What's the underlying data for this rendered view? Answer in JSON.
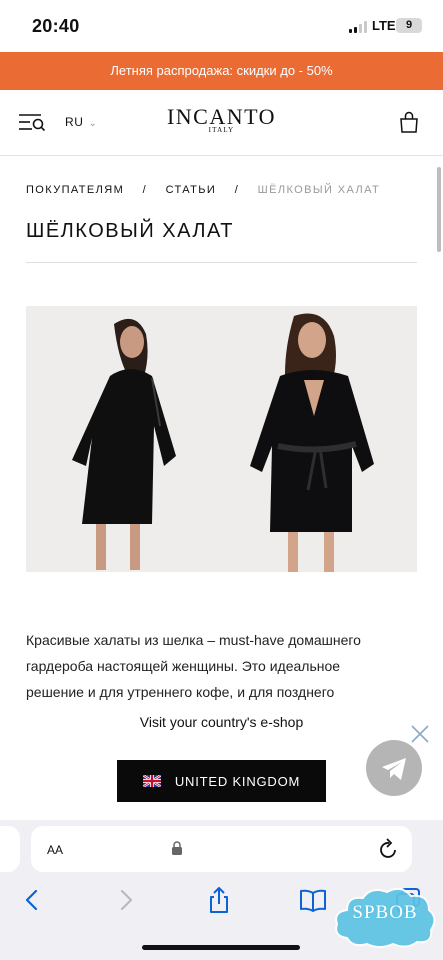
{
  "status_bar": {
    "time": "20:40",
    "network": "LTE",
    "battery": "9"
  },
  "promo": {
    "text": "Летняя распродажа: скидки до - 50%"
  },
  "header": {
    "language": "RU",
    "logo_main": "INCANTO",
    "logo_sub": "ITALY"
  },
  "breadcrumbs": [
    "ПОКУПАТЕЛЯМ",
    "СТАТЬИ",
    "ШЁЛКОВЫЙ ХАЛАТ"
  ],
  "breadcrumb_separator": "/",
  "page_title": "ШЁЛКОВЫЙ ХАЛАТ",
  "article": {
    "lines": [
      "Красивые халаты из шелка – must-have домашнего",
      "гардероба настоящей женщины. Это идеальное",
      "решение и для утреннего кофе, и для позднего"
    ]
  },
  "country_banner": {
    "text": "Visit your country's e-shop",
    "button_label": "UNITED KINGDOM"
  },
  "browser": {
    "text_size_label": "AA"
  },
  "watermark": {
    "text": "SPBOB"
  },
  "colors": {
    "promo": "#ea6c34",
    "button": "#0a0a0a",
    "telegram_button": "#b5b5b5",
    "safari_blue": "#0a64d8"
  },
  "icons": [
    "menu-search-icon",
    "chevron-down-icon",
    "shopping-bag-icon",
    "close-icon",
    "telegram-icon",
    "lock-icon",
    "reload-icon",
    "back-icon",
    "forward-icon",
    "share-icon",
    "bookmarks-icon",
    "tabs-icon",
    "uk-flag-icon"
  ]
}
